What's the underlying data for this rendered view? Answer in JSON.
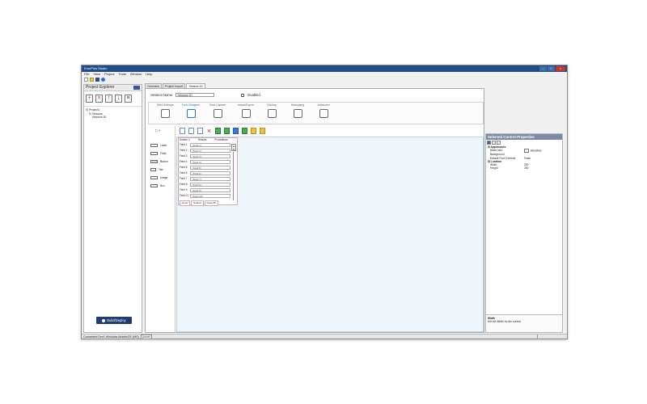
{
  "window": {
    "title": "EmuPlus Studio",
    "controls": [
      "–",
      "□",
      "×"
    ]
  },
  "menu": [
    "File",
    "View",
    "Project",
    "Tools",
    "Window",
    "Help"
  ],
  "toolbar": {
    "icons": [
      "new-file-icon",
      "open-folder-icon",
      "save-icon",
      "help-icon"
    ]
  },
  "explorer": {
    "title": "Project Explorer",
    "tools": [
      "add-icon",
      "delete-icon",
      "move-up-icon",
      "move-down-icon",
      "properties-icon"
    ],
    "tree": [
      "⊟ Project1",
      "⊟ Session",
      "Session ID"
    ],
    "build_label": "Build/Deploy"
  },
  "tabs": [
    "Overview",
    "Project Import",
    "Session ID"
  ],
  "session": {
    "label": "Session Name:",
    "value": "Session ID",
    "enabled_label": "Enabled"
  },
  "categories": [
    {
      "label": "Field Settings",
      "icon": "wrench-icon",
      "active": false
    },
    {
      "label": "Form Designer",
      "icon": "pencil-icon",
      "active": true
    },
    {
      "label": "Data Capture",
      "icon": "signal-icon",
      "active": false
    },
    {
      "label": "Import/Export",
      "icon": "document-icon",
      "active": false
    },
    {
      "label": "Printing",
      "icon": "printer-icon",
      "active": false
    },
    {
      "label": "Messaging",
      "icon": "chat-icon",
      "active": false
    },
    {
      "label": "Advanced",
      "icon": "gear-icon",
      "active": false
    }
  ],
  "palette": [
    "Label",
    "Field",
    "Button",
    "Tab",
    "Image",
    "Box"
  ],
  "form": {
    "header": [
      "Screen 1",
      "Results",
      "Procedures"
    ],
    "fields": [
      {
        "label": "Field 1",
        "value": "<Field 1>"
      },
      {
        "label": "Field 2",
        "value": "<Field 2>"
      },
      {
        "label": "Field 3",
        "value": "<Field 3>"
      },
      {
        "label": "Field 4",
        "value": "<Field 4>"
      },
      {
        "label": "Field 5",
        "value": "<Field 5>"
      },
      {
        "label": "Field 6",
        "value": "<Field 6>"
      },
      {
        "label": "Field 7",
        "value": "<Field 7>"
      },
      {
        "label": "Field 8",
        "value": "<Field 8>"
      },
      {
        "label": "Field 9",
        "value": "<Field 9>"
      },
      {
        "label": "Field 10",
        "value": "<Field 10>"
      }
    ],
    "buttons": [
      "Done",
      "Submit",
      "Clear All"
    ]
  },
  "properties": {
    "title": "Selected Control Properties",
    "rows": [
      {
        "key": "⊟ Appearance",
        "value": "",
        "category": true
      },
      {
        "key": "BackColor",
        "value": "AliceBlue",
        "swatch": true
      },
      {
        "key": "Background",
        "value": ""
      },
      {
        "key": "Default Font Override",
        "value": "False"
      },
      {
        "key": "⊟ Location",
        "value": "",
        "category": true
      },
      {
        "key": "Width",
        "value": "290"
      },
      {
        "key": "Height",
        "value": "250"
      }
    ],
    "desc_title": "Width",
    "desc_text": "Set the Width for the control"
  },
  "status": {
    "text": "Connected Dev1 Windows Mobile/CE (MS)",
    "tag": "(none)"
  }
}
